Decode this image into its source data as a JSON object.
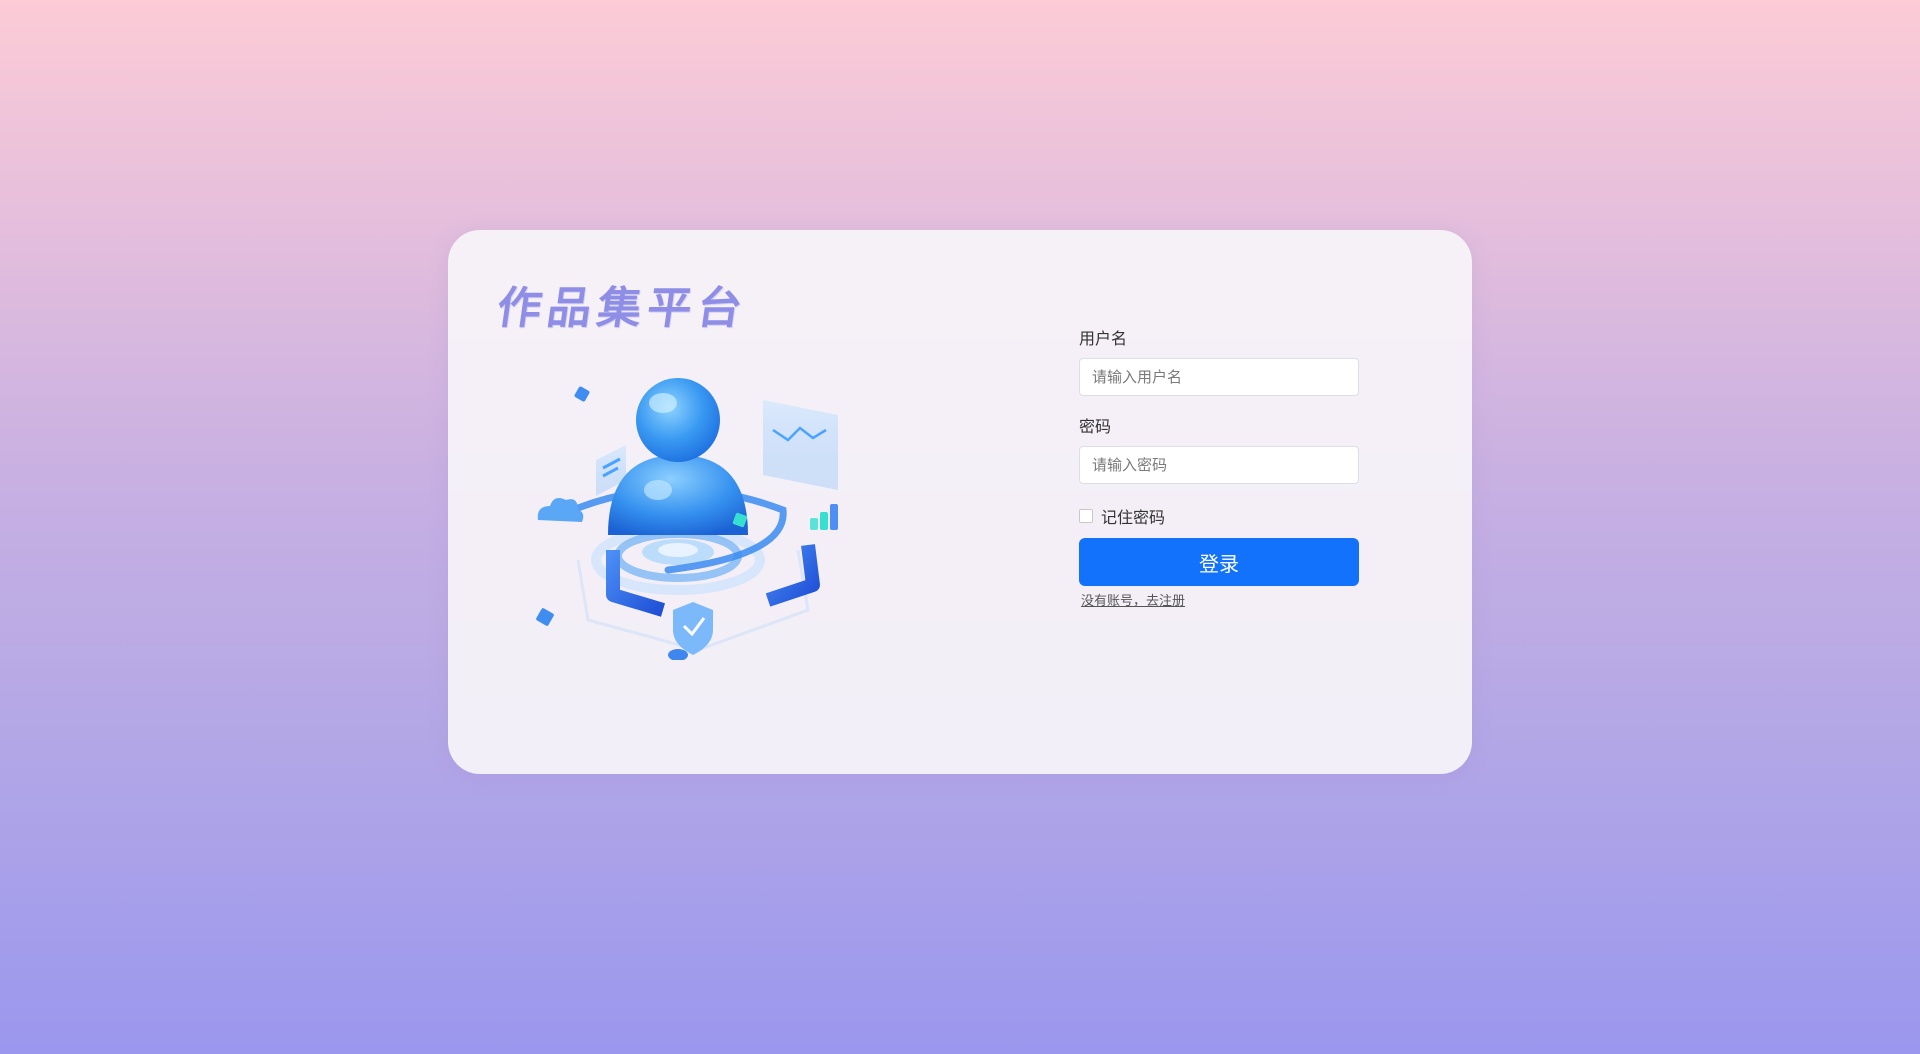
{
  "brand": {
    "title": "作品集平台"
  },
  "login_form": {
    "username_label": "用户名",
    "username_placeholder": "请输入用户名",
    "password_label": "密码",
    "password_placeholder": "请输入密码",
    "remember_label": "记住密码",
    "remember_checked": false,
    "submit_label": "登录",
    "register_link": "没有账号，去注册"
  },
  "colors": {
    "primary": "#1372fb",
    "brand_title": "#8f8ee6",
    "background_top": "#fccbd6",
    "background_bottom": "#9b97ee"
  },
  "illustration": {
    "icon": "user-avatar-3d-icon"
  }
}
